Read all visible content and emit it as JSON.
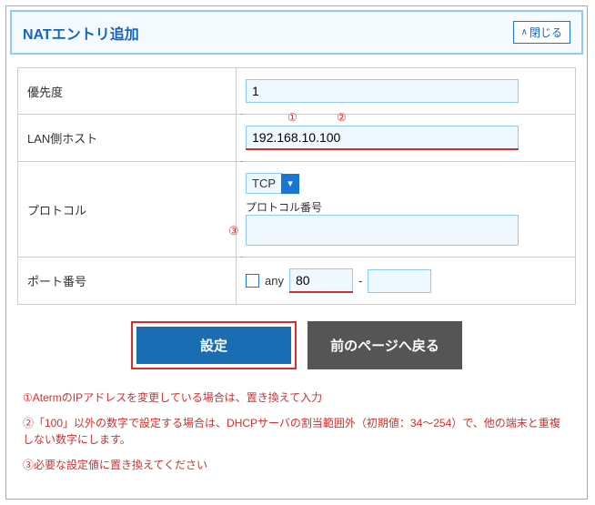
{
  "header": {
    "title": "NATエントリ追加",
    "close": "閉じる"
  },
  "form": {
    "priority": {
      "label": "優先度",
      "value": "1"
    },
    "lanhost": {
      "label": "LAN側ホスト",
      "value": "192.168.10.100",
      "anno1": "①",
      "anno2": "②"
    },
    "protocol": {
      "label": "プロトコル",
      "selected": "TCP",
      "numLabel": "プロトコル番号",
      "numValue": "",
      "anno3": "③"
    },
    "port": {
      "label": "ポート番号",
      "anyLabel": "any",
      "from": "80",
      "to": "",
      "dash": "-"
    }
  },
  "buttons": {
    "submit": "設定",
    "back": "前のページへ戻る"
  },
  "notes": {
    "n1": "①AtermのIPアドレスを変更している場合は、置き換えて入力",
    "n2": "②「100」以外の数字で設定する場合は、DHCPサーバの割当範囲外（初期値：34～254）で、他の端末と重複しない数字にします。",
    "n3": "③必要な設定値に置き換えてください"
  }
}
